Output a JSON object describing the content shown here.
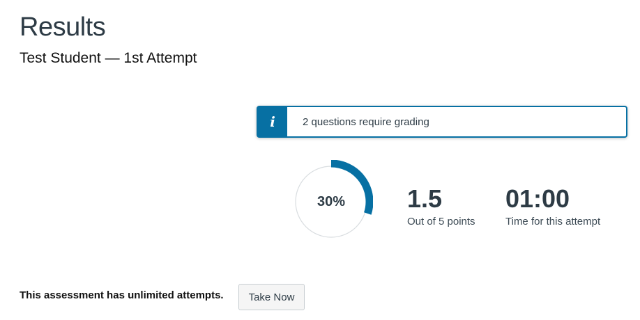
{
  "header": {
    "title": "Results",
    "attempt": "Test Student — 1st Attempt"
  },
  "alert": {
    "icon": "info-icon",
    "icon_glyph": "i",
    "message": "2 questions require grading",
    "color": "#0770a3"
  },
  "score": {
    "percent_label": "30%",
    "percent_value": 0.3,
    "ring_color": "#0770a3",
    "points": "1.5",
    "points_caption": "Out of 5 points",
    "time": "01:00",
    "time_caption": "Time for this attempt"
  },
  "footer": {
    "attempts_text": "This assessment has unlimited attempts.",
    "take_now_label": "Take Now"
  }
}
